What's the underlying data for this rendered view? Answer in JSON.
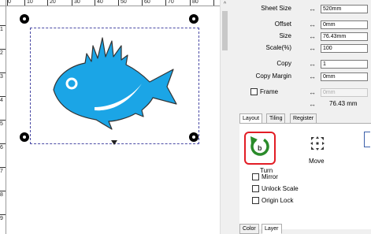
{
  "ruler": {
    "top": [
      "0",
      "10",
      "20",
      "30",
      "40",
      "50",
      "60",
      "70",
      "80"
    ],
    "left": [
      "1",
      "2",
      "3",
      "4",
      "5",
      "6",
      "7",
      "8",
      "9"
    ]
  },
  "canvas": {
    "fish_color": "#1ba5e6",
    "fish_outline_color": "#333333",
    "selection_color": "#4a4aa5"
  },
  "panel": {
    "sheet_size": {
      "label": "Sheet Size",
      "arrow": "↔",
      "value": "520mm"
    },
    "offset": {
      "label": "Offset",
      "arrow": "↔",
      "value": "0mm"
    },
    "size": {
      "label": "Size",
      "arrow": "↔",
      "value": "76.43mm"
    },
    "scale": {
      "label": "Scale(%)",
      "arrow": "↔",
      "value": "100"
    },
    "copy": {
      "label": "Copy",
      "arrow": "↔",
      "value": "1"
    },
    "copy_margin": {
      "label": "Copy Margin",
      "arrow": "↔",
      "value": "0mm"
    },
    "frame": {
      "label": "Frame",
      "arrow": "↔",
      "value": "0mm"
    },
    "frame_total": {
      "arrow": "↔",
      "value": "76.43 mm"
    },
    "tabs": [
      "Layout",
      "Tiling",
      "Register Mark"
    ],
    "layout": {
      "turn_label": "Turn",
      "move_label": "Move",
      "turn_accent": "#e21d25",
      "turn_icon_color": "#2a8b2a",
      "mirror_label": "Mirror",
      "unlock_scale_label": "Unlock Scale",
      "origin_lock_label": "Origin Lock"
    },
    "bottom_tabs": [
      "Color",
      "Layer"
    ]
  }
}
